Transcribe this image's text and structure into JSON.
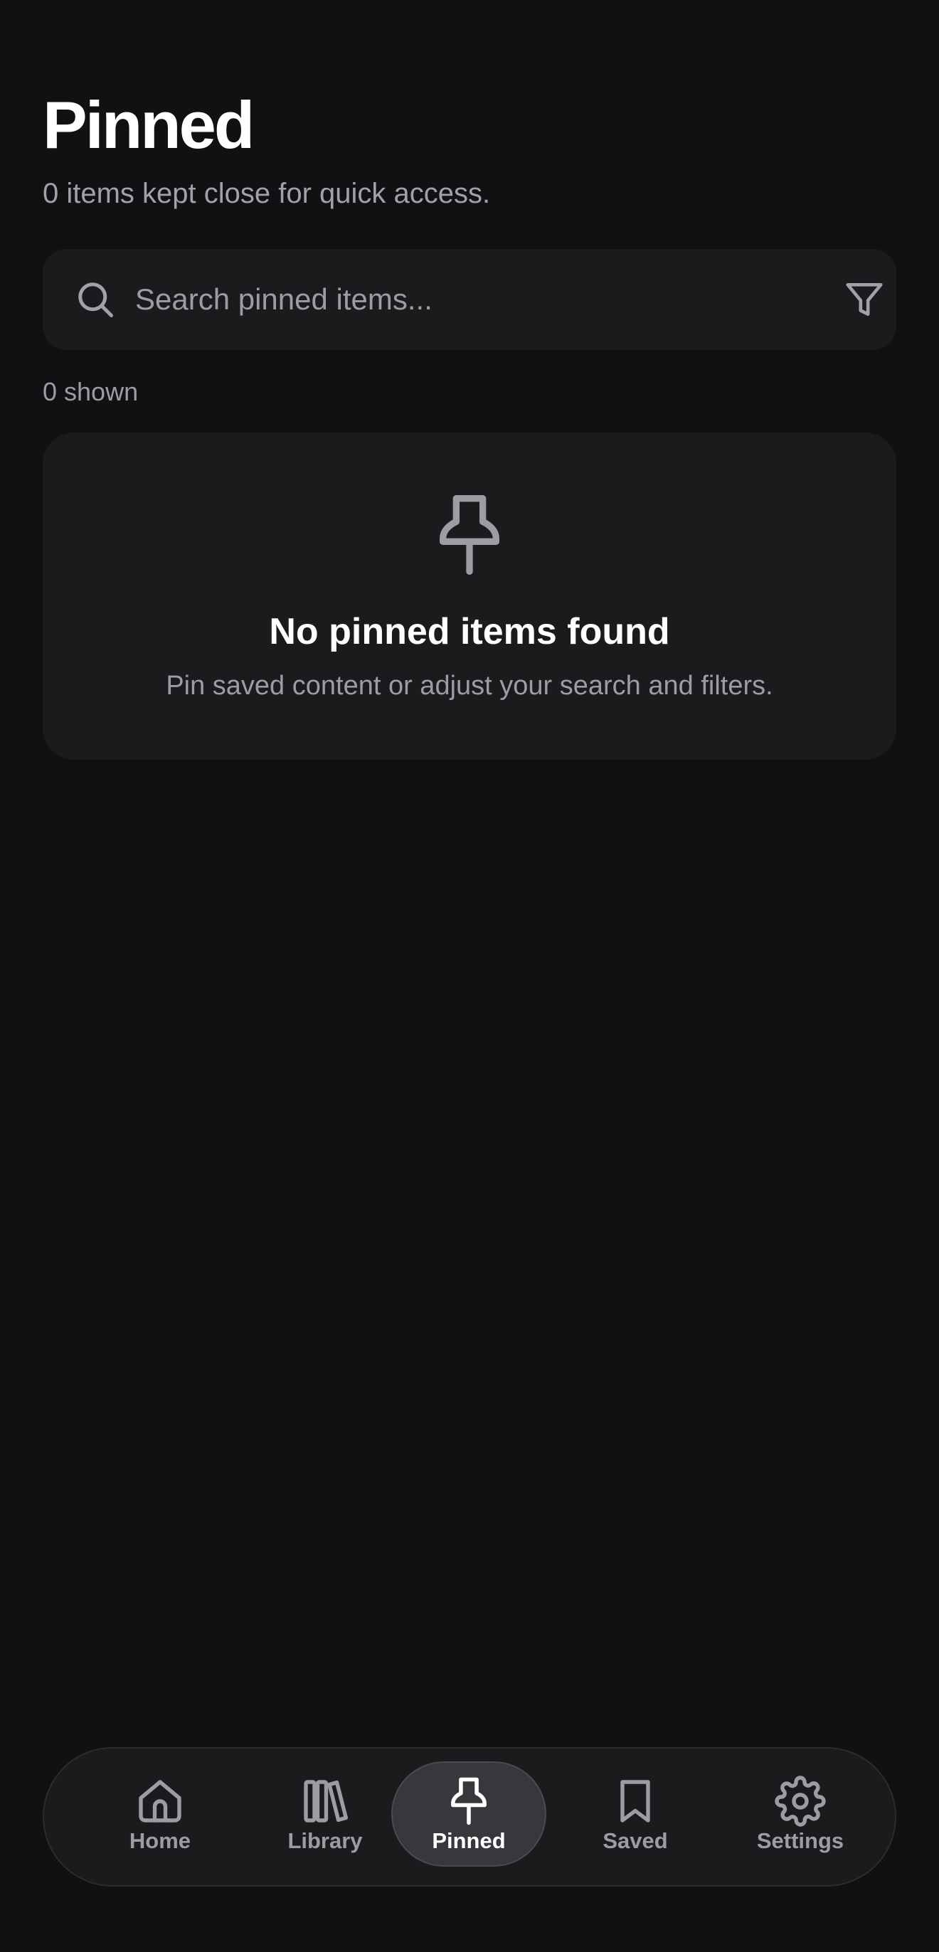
{
  "header": {
    "title": "Pinned",
    "subtitle": "0 items kept close for quick access."
  },
  "search": {
    "placeholder": "Search pinned items...",
    "value": ""
  },
  "results": {
    "count_label": "0 shown"
  },
  "empty_state": {
    "icon": "pin-icon",
    "title": "No pinned items found",
    "description": "Pin saved content or adjust your search and filters."
  },
  "tabbar": {
    "items": [
      {
        "label": "Home",
        "icon": "home-icon",
        "active": false
      },
      {
        "label": "Library",
        "icon": "library-icon",
        "active": false
      },
      {
        "label": "Pinned",
        "icon": "pin-icon",
        "active": true
      },
      {
        "label": "Saved",
        "icon": "bookmark-icon",
        "active": false
      },
      {
        "label": "Settings",
        "icon": "gear-icon",
        "active": false
      }
    ]
  },
  "colors": {
    "background": "#111113",
    "surface": "#1b1b1e",
    "muted_text": "#9c9ca3",
    "active_tab": "#38383c"
  }
}
